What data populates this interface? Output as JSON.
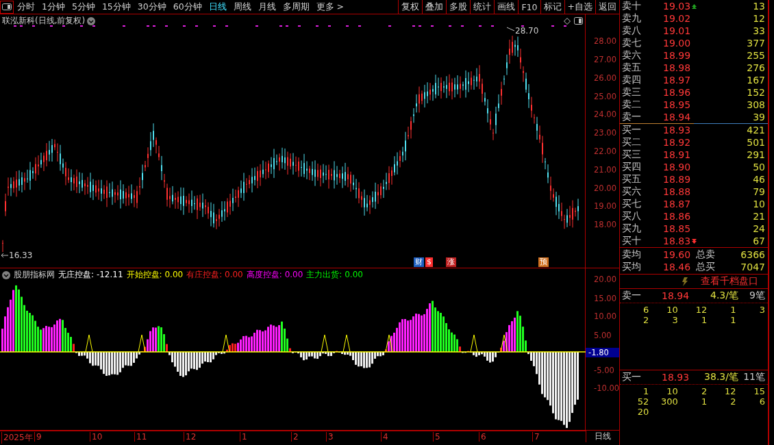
{
  "toolbar": {
    "periods": [
      {
        "label": "分时",
        "selected": false
      },
      {
        "label": "1分钟",
        "selected": false
      },
      {
        "label": "5分钟",
        "selected": false
      },
      {
        "label": "15分钟",
        "selected": false
      },
      {
        "label": "30分钟",
        "selected": false
      },
      {
        "label": "60分钟",
        "selected": false
      },
      {
        "label": "日线",
        "selected": true
      },
      {
        "label": "周线",
        "selected": false
      },
      {
        "label": "月线",
        "selected": false
      },
      {
        "label": "多周期",
        "selected": false
      }
    ],
    "more": "更多 >",
    "buttons": [
      "复权",
      "叠加",
      "多股",
      "统计",
      "画线",
      "F10",
      "标记",
      "+自选",
      "返回"
    ]
  },
  "chart": {
    "title": "联泓新科(日线,前复权)",
    "high_label": "28.70",
    "low_label": "16.33",
    "price_ticks": [
      "28.00",
      "27.00",
      "26.00",
      "25.00",
      "24.00",
      "23.00",
      "22.00",
      "21.00",
      "20.00",
      "19.00",
      "18.00"
    ],
    "event_marks": [
      {
        "label": "财",
        "color": "#2060c0"
      },
      {
        "label": "$",
        "color": "#ff3030"
      },
      {
        "label": "涨",
        "color": "#c02020"
      },
      {
        "label": "预",
        "color": "#d07020"
      }
    ]
  },
  "indicator": {
    "name": "股朋指标网",
    "readings": [
      {
        "label": "无庄控盘:",
        "value": "-12.11",
        "color": "#ffffff"
      },
      {
        "label": "开始控盘:",
        "value": "0.00",
        "color": "#ffff00"
      },
      {
        "label": "有庄控盘:",
        "value": "0.00",
        "color": "#ff2020"
      },
      {
        "label": "高度控盘:",
        "value": "0.00",
        "color": "#ff00ff"
      },
      {
        "label": "主力出货:",
        "value": "0.00",
        "color": "#00ff00"
      }
    ],
    "ticks": [
      "20.00",
      "15.00",
      "10.00",
      "5.00",
      "-5.00",
      "-10.00"
    ],
    "current": "-1.80"
  },
  "date_axis": {
    "labels": [
      "2025年",
      "9",
      "10",
      "11",
      "12",
      "1",
      "2",
      "3",
      "4",
      "5",
      "6",
      "7"
    ],
    "period": "日线"
  },
  "order_book": {
    "asks": [
      {
        "label": "卖十",
        "price": "19.03",
        "volume": "13"
      },
      {
        "label": "卖九",
        "price": "19.02",
        "volume": "12"
      },
      {
        "label": "卖八",
        "price": "19.01",
        "volume": "33"
      },
      {
        "label": "卖七",
        "price": "19.00",
        "volume": "377"
      },
      {
        "label": "卖六",
        "price": "18.99",
        "volume": "255"
      },
      {
        "label": "卖五",
        "price": "18.98",
        "volume": "276"
      },
      {
        "label": "卖四",
        "price": "18.97",
        "volume": "167"
      },
      {
        "label": "卖三",
        "price": "18.96",
        "volume": "152"
      },
      {
        "label": "卖二",
        "price": "18.95",
        "volume": "308"
      },
      {
        "label": "卖一",
        "price": "18.94",
        "volume": "39"
      }
    ],
    "bids": [
      {
        "label": "买一",
        "price": "18.93",
        "volume": "421"
      },
      {
        "label": "买二",
        "price": "18.92",
        "volume": "501"
      },
      {
        "label": "买三",
        "price": "18.91",
        "volume": "291"
      },
      {
        "label": "买四",
        "price": "18.90",
        "volume": "50"
      },
      {
        "label": "买五",
        "price": "18.89",
        "volume": "46"
      },
      {
        "label": "买六",
        "price": "18.88",
        "volume": "79"
      },
      {
        "label": "买七",
        "price": "18.87",
        "volume": "10"
      },
      {
        "label": "买八",
        "price": "18.86",
        "volume": "21"
      },
      {
        "label": "买九",
        "price": "18.85",
        "volume": "24"
      },
      {
        "label": "买十",
        "price": "18.83",
        "volume": "67"
      }
    ],
    "summary": [
      {
        "label": "卖均",
        "price": "19.60",
        "total_label": "总卖",
        "total": "6366"
      },
      {
        "label": "买均",
        "price": "18.46",
        "total_label": "总买",
        "total": "7047"
      }
    ],
    "detail_link": "查看千档盘口",
    "queues": [
      {
        "label": "卖一",
        "price": "18.94",
        "avg": "4.3/笔",
        "count": "9笔",
        "orders": [
          "6",
          "10",
          "12",
          "1",
          "3",
          "2",
          "3",
          "1",
          "1"
        ]
      },
      {
        "label": "买一",
        "price": "18.93",
        "avg": "38.3/笔",
        "count": "11笔",
        "orders": [
          "1",
          "10",
          "2",
          "12",
          "15",
          "52",
          "300",
          "1",
          "2",
          "6",
          "20"
        ]
      }
    ]
  }
}
